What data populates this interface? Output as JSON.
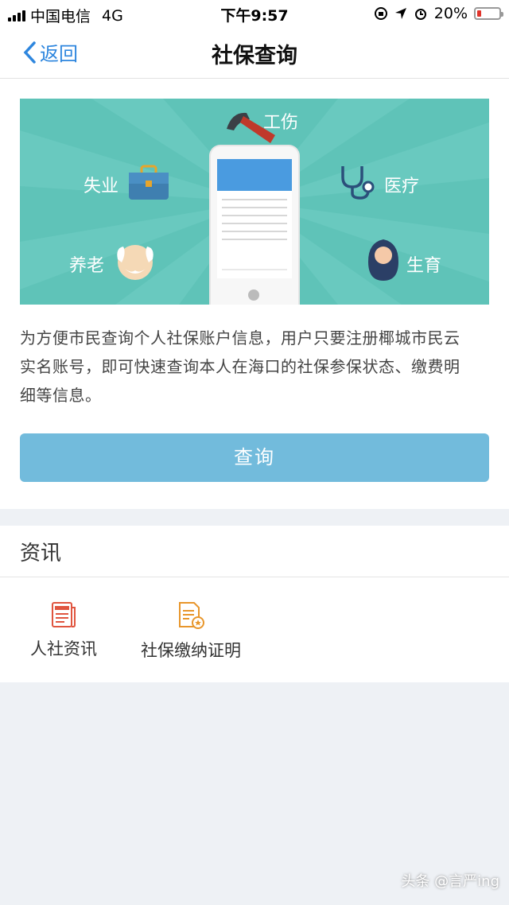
{
  "status_bar": {
    "carrier": "中国电信",
    "network": "4G",
    "time": "下午9:57",
    "battery_percent": "20%",
    "battery_level": 0.2
  },
  "nav": {
    "back_label": "返回",
    "title": "社保查询"
  },
  "banner": {
    "labels": {
      "injury": "工伤",
      "unemployment": "失业",
      "medical": "医疗",
      "pension": "养老",
      "maternity": "生育"
    }
  },
  "description_lines": [
    "为方便市民查询个人社保账户信息，用户只要注册椰城市民云",
    "实名账号，即可快速查询本人在海口的社保参保状态、缴费明",
    "细等信息。"
  ],
  "query_button": "查询",
  "news": {
    "title": "资讯",
    "items": [
      {
        "label": "人社资讯",
        "icon": "news-icon"
      },
      {
        "label": "社保缴纳证明",
        "icon": "certificate-icon"
      }
    ]
  },
  "watermark": "头条 @言严ing",
  "colors": {
    "accent": "#2e86de",
    "banner_bg": "#5fc3b8",
    "button_bg": "#72bbdc",
    "page_bg": "#eef1f5"
  }
}
